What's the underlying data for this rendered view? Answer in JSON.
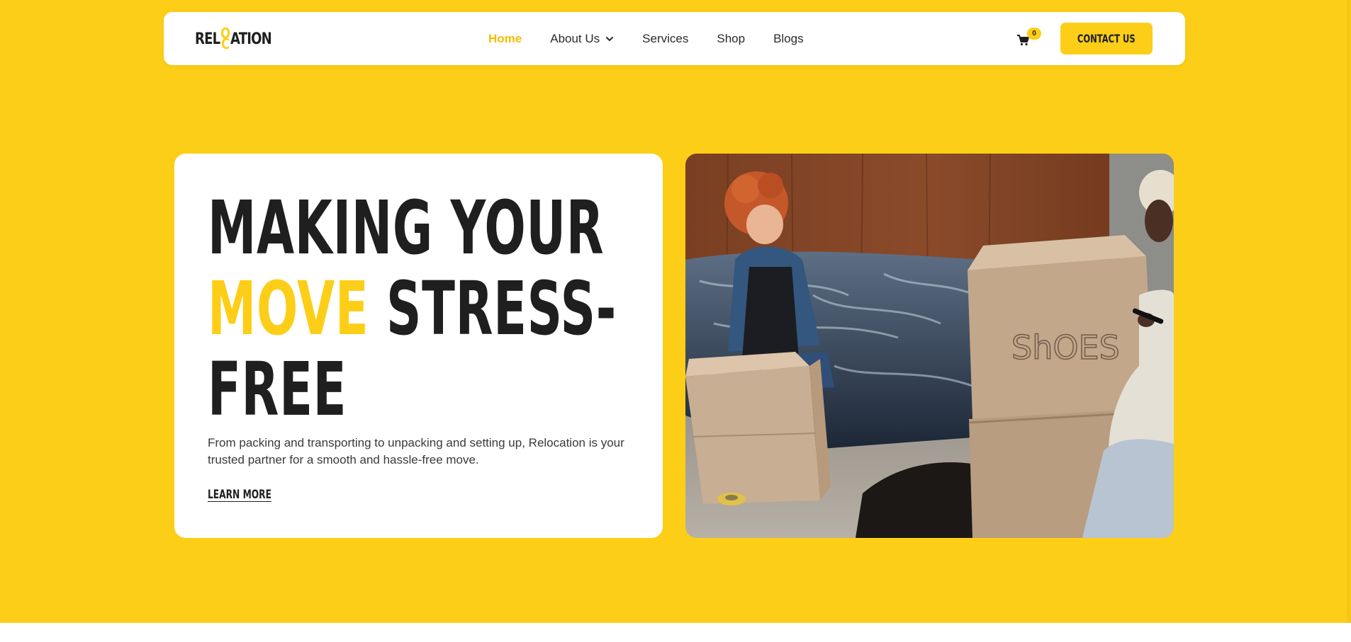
{
  "brand": {
    "name_left": "REL",
    "name_mid_top": "O",
    "name_mid_bottom": "C",
    "name_right": "ATION",
    "accent_color": "#fdce17",
    "dark_color": "#1f1f1f"
  },
  "nav": {
    "items": [
      {
        "label": "Home",
        "active": true
      },
      {
        "label": "About Us",
        "has_dropdown": true
      },
      {
        "label": "Services"
      },
      {
        "label": "Shop"
      },
      {
        "label": "Blogs"
      }
    ]
  },
  "cart": {
    "icon": "cart-icon",
    "count": "0"
  },
  "header_cta": {
    "label": "CONTACT US"
  },
  "hero": {
    "headline_line1": "MAKING YOUR",
    "headline_highlight": "MOVE",
    "headline_line2_rest": "STRESS-",
    "headline_line3": "FREE",
    "description": "From packing and transporting to unpacking and setting up, Relocation is your trusted partner for a smooth and hassle-free move.",
    "cta_label": "LEARN MORE",
    "photo_box_writing": "ShOES"
  }
}
